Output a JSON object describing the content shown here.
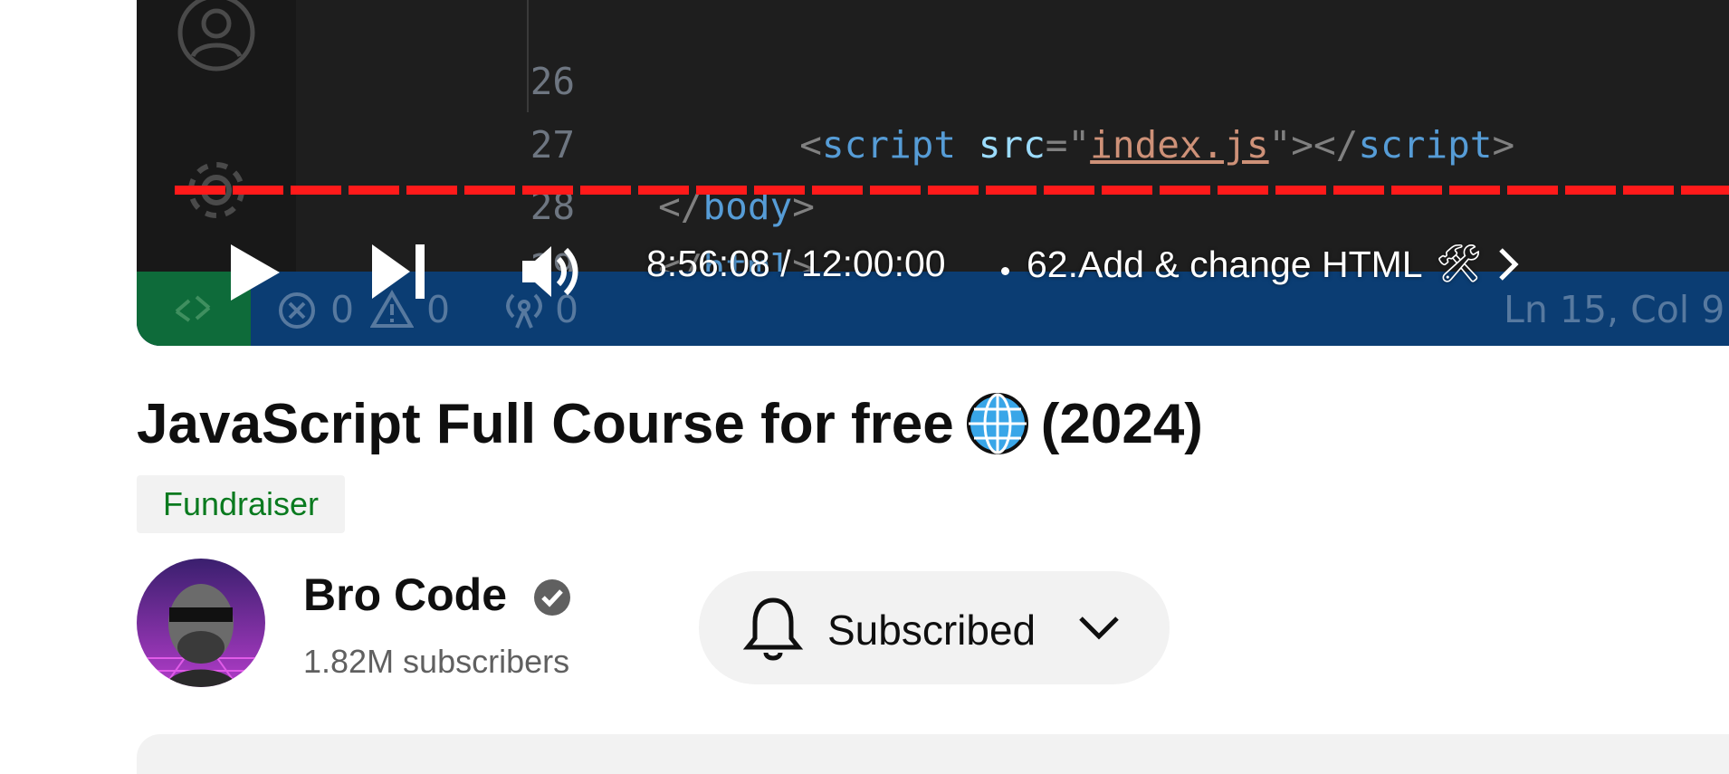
{
  "player": {
    "code_lines": [
      {
        "number": "26",
        "parts": []
      },
      {
        "number": "27",
        "parts": [
          {
            "text": "      <",
            "kind": "punct"
          },
          {
            "text": "script",
            "kind": "tag"
          },
          {
            "text": " ",
            "kind": "punct"
          },
          {
            "text": "src",
            "kind": "attr"
          },
          {
            "text": "=\"",
            "kind": "punct"
          },
          {
            "text": "index.js",
            "kind": "str"
          },
          {
            "text": "\"></",
            "kind": "punct"
          },
          {
            "text": "script",
            "kind": "tag"
          },
          {
            "text": ">",
            "kind": "punct"
          }
        ]
      },
      {
        "number": "28",
        "parts": [
          {
            "text": "</",
            "kind": "punct"
          },
          {
            "text": "body",
            "kind": "tag"
          },
          {
            "text": ">",
            "kind": "punct"
          }
        ]
      },
      {
        "number": "29",
        "parts": [
          {
            "text": "</",
            "kind": "punct"
          },
          {
            "text": "html",
            "kind": "tag"
          },
          {
            "text": ">",
            "kind": "punct"
          }
        ]
      }
    ],
    "statusbar": {
      "errors": "0",
      "warnings": "0",
      "ports": "0",
      "cursor_position": "Ln 15, Col 9"
    },
    "time_display": "8:56:08 / 12:00:00",
    "chapter_title": "62.Add & change HTML",
    "chapter_emoji": "🛠",
    "progress_fraction": 0.745,
    "icons": [
      "play-icon",
      "next-icon",
      "volume-icon",
      "chevron-right-icon",
      "account-icon",
      "gear-icon"
    ]
  },
  "video": {
    "title": "JavaScript Full Course for free",
    "title_emoji": "🌐",
    "title_year": "(2024)",
    "badge": "Fundraiser"
  },
  "channel": {
    "name": "Bro Code",
    "subscribers": "1.82M subscribers",
    "subscribe_label": "Subscribed"
  },
  "colors": {
    "progress": "#ff1a1a",
    "badge_text": "#0a7a1f",
    "statusbar": "#0b3d73"
  }
}
